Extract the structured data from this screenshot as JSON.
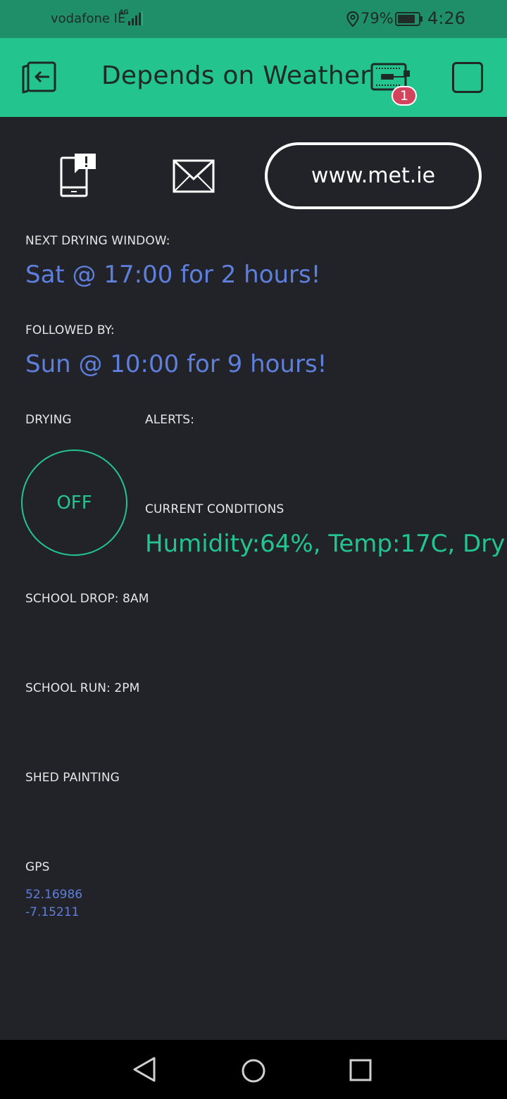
{
  "status_bar": {
    "carrier": "vodafone IE",
    "network": "4G",
    "battery_percent": "79%",
    "time": "4:26",
    "icons": [
      "signal-icon",
      "location-icon",
      "battery-icon"
    ]
  },
  "header": {
    "title": "Depends on Weather",
    "device_badge": "1",
    "icons": [
      "exit-icon",
      "device-icon",
      "stop-icon"
    ]
  },
  "widgets": {
    "link_button_label": "www.met.ie",
    "icons": [
      "notification-icon",
      "mail-icon"
    ]
  },
  "next_drying": {
    "label": "NEXT DRYING WINDOW:",
    "value": "Sat @ 17:00 for 2 hours!"
  },
  "followed_by": {
    "label": "FOLLOWED BY:",
    "value": "Sun @ 10:00 for 9 hours!"
  },
  "drying": {
    "label": "DRYING",
    "button_label": "OFF"
  },
  "alerts": {
    "label": "ALERTS:"
  },
  "current_conditions": {
    "label": "CURRENT CONDITIONS",
    "value": "Humidity:64%, Temp:17C, Dry"
  },
  "school_drop": {
    "label": "SCHOOL DROP: 8AM"
  },
  "school_run": {
    "label": "SCHOOL RUN: 2PM"
  },
  "shed_painting": {
    "label": "SHED PAINTING"
  },
  "gps": {
    "label": "GPS",
    "lat": "52.16986",
    "lon": "-7.15211"
  },
  "colors": {
    "accent_green": "#23c48e",
    "status_green": "#1e8f68",
    "background": "#212329",
    "value_blue": "#5f7fdc",
    "badge_red": "#d3435c"
  }
}
